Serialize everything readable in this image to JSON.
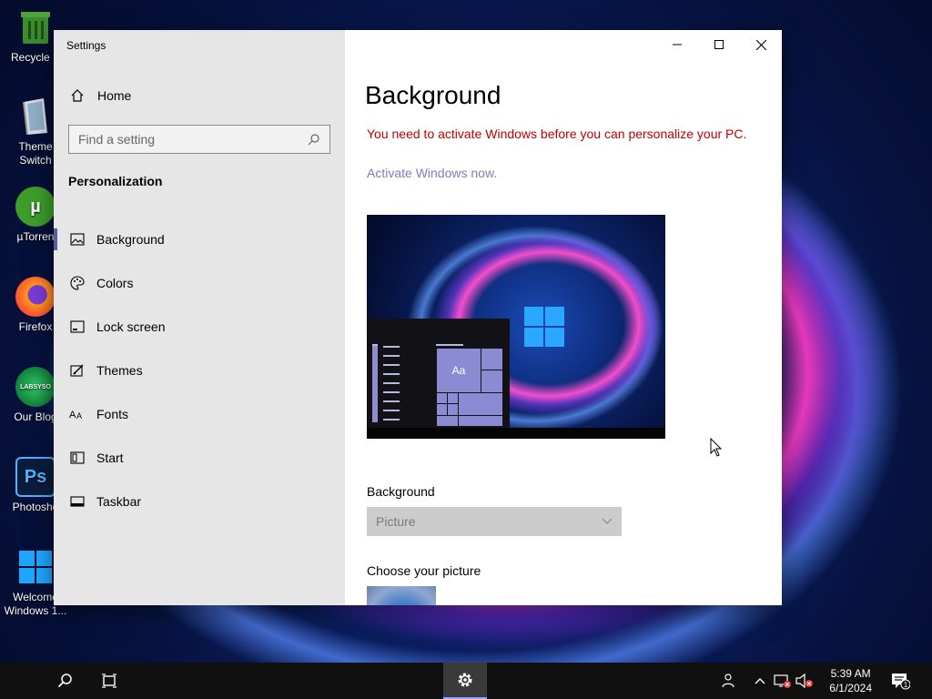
{
  "desktop": {
    "icons": [
      {
        "label": "Recycle B",
        "icon": "recycle-bin-icon"
      },
      {
        "label": "Theme Switch",
        "label2": "Switch",
        "label1": "Theme",
        "icon": "theme-switch-icon"
      },
      {
        "label": "µTorren",
        "icon": "utorrent-icon"
      },
      {
        "label": "Firefox",
        "icon": "firefox-icon"
      },
      {
        "label": "Our Blog",
        "icon": "blog-icon",
        "badge": "LABSYSO"
      },
      {
        "label": "Photosho",
        "icon": "photoshop-icon",
        "badge": "Ps"
      },
      {
        "label": "Welcome Windows 1...",
        "label1": "Welcome",
        "label2": "Windows 1...",
        "icon": "windows-icon"
      }
    ]
  },
  "window": {
    "title": "Settings",
    "sidebar": {
      "home": "Home",
      "search_placeholder": "Find a setting",
      "section": "Personalization",
      "items": [
        {
          "label": "Background",
          "icon": "picture-icon",
          "active": true
        },
        {
          "label": "Colors",
          "icon": "palette-icon"
        },
        {
          "label": "Lock screen",
          "icon": "lock-screen-icon"
        },
        {
          "label": "Themes",
          "icon": "themes-icon"
        },
        {
          "label": "Fonts",
          "icon": "fonts-icon"
        },
        {
          "label": "Start",
          "icon": "start-icon"
        },
        {
          "label": "Taskbar",
          "icon": "taskbar-icon"
        }
      ]
    },
    "main": {
      "title": "Background",
      "warning": "You need to activate Windows before you can personalize your PC.",
      "activate_link": "Activate Windows now.",
      "preview_tile_text": "Aa",
      "background_label": "Background",
      "background_value": "Picture",
      "choose_label": "Choose your picture"
    }
  },
  "taskbar": {
    "time": "5:39 AM",
    "date": "6/1/2024",
    "notification_count": "1"
  },
  "colors": {
    "warning": "#c00000",
    "link": "#7c7cc2",
    "accent": "#5c5ca3"
  }
}
